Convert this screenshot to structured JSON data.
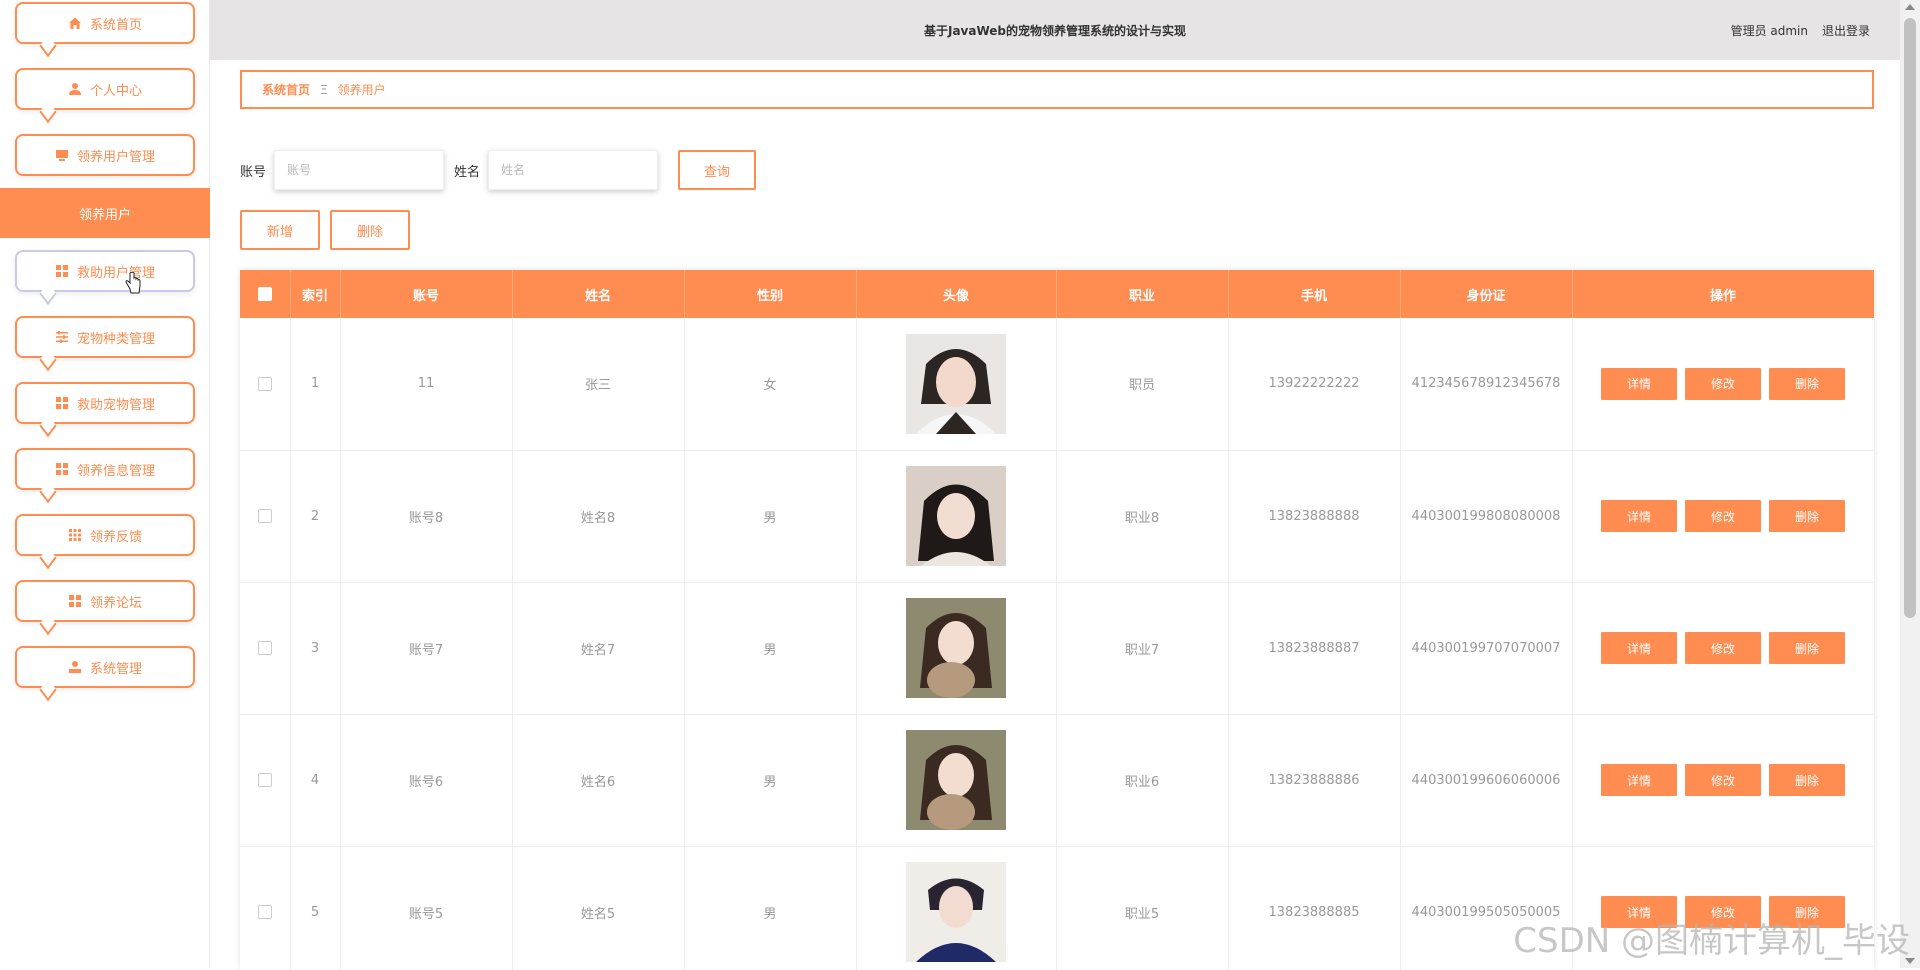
{
  "theme": {
    "accent": "#ff8c50"
  },
  "header": {
    "title": "基于JavaWeb的宠物领养管理系统的设计与实现",
    "user_label": "管理员 admin",
    "logout_label": "退出登录"
  },
  "sidebar": {
    "items": [
      {
        "label": "系统首页",
        "icon": "home-icon"
      },
      {
        "label": "个人中心",
        "icon": "person-icon"
      },
      {
        "label": "领养用户管理",
        "icon": "monitor-icon"
      },
      {
        "label": "救助用户管理",
        "icon": "grid-icon"
      },
      {
        "label": "宠物种类管理",
        "icon": "sliders-icon"
      },
      {
        "label": "救助宠物管理",
        "icon": "grid-icon"
      },
      {
        "label": "领养信息管理",
        "icon": "grid-icon"
      },
      {
        "label": "领养反馈",
        "icon": "apps-icon"
      },
      {
        "label": "领养论坛",
        "icon": "grid-icon"
      },
      {
        "label": "系统管理",
        "icon": "user-icon"
      }
    ],
    "active_submenu": "领养用户"
  },
  "breadcrumb": {
    "home": "系统首页",
    "separator": "Ξ",
    "current": "领养用户"
  },
  "search": {
    "account_label": "账号",
    "account_placeholder": "账号",
    "name_label": "姓名",
    "name_placeholder": "姓名",
    "query_label": "查询"
  },
  "actions": {
    "add_label": "新增",
    "delete_label": "删除"
  },
  "table": {
    "columns": [
      "索引",
      "账号",
      "姓名",
      "性别",
      "头像",
      "职业",
      "手机",
      "身份证",
      "操作"
    ],
    "ops": {
      "detail": "详情",
      "edit": "修改",
      "delete": "删除"
    },
    "rows": [
      {
        "index": "1",
        "account": "11",
        "name": "张三",
        "gender": "女",
        "job": "职员",
        "phone": "13922222222",
        "id_card": "412345678912345678"
      },
      {
        "index": "2",
        "account": "账号8",
        "name": "姓名8",
        "gender": "男",
        "job": "职业8",
        "phone": "13823888888",
        "id_card": "440300199808080008"
      },
      {
        "index": "3",
        "account": "账号7",
        "name": "姓名7",
        "gender": "男",
        "job": "职业7",
        "phone": "13823888887",
        "id_card": "440300199707070007"
      },
      {
        "index": "4",
        "account": "账号6",
        "name": "姓名6",
        "gender": "男",
        "job": "职业6",
        "phone": "13823888886",
        "id_card": "440300199606060006"
      },
      {
        "index": "5",
        "account": "账号5",
        "name": "姓名5",
        "gender": "男",
        "job": "职业5",
        "phone": "13823888885",
        "id_card": "440300199505050005"
      }
    ]
  },
  "watermark": "CSDN @图楠计算机_毕设"
}
